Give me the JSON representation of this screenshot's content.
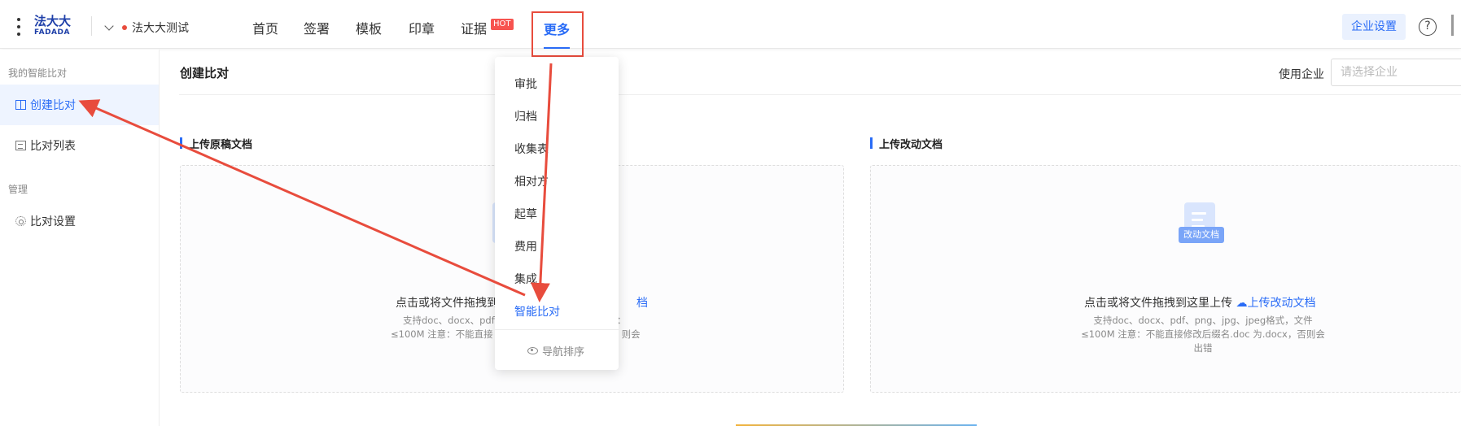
{
  "header": {
    "logo_top": "法大大",
    "logo_bottom": "FADADA",
    "org_name": "法大大测试",
    "nav": [
      "首页",
      "签署",
      "模板",
      "印章",
      "证据"
    ],
    "hot_badge": "HOT",
    "more_label": "更多",
    "settings_button": "企业设置",
    "help_glyph": "?"
  },
  "sidebar": {
    "group1": "我的智能比对",
    "items": [
      {
        "label": "创建比对"
      },
      {
        "label": "比对列表"
      }
    ],
    "group2": "管理",
    "settings_item": "比对设置"
  },
  "main": {
    "title": "创建比对",
    "enterprise_label": "使用企业",
    "enterprise_placeholder": "请选择企业",
    "original": {
      "section_title": "上传原稿文档",
      "prompt_a": "点击或将文件拖拽到",
      "prompt_link": "档",
      "hint_line1a": "支持doc、docx、pdf",
      "hint_line1b": "：",
      "hint_line2a": "≤100M 注意：不能直接",
      "hint_line2b": "则会"
    },
    "revised": {
      "section_title": "上传改动文档",
      "icon_tag": "改动文档",
      "prompt": "点击或将文件拖拽到这里上传",
      "link": "上传改动文档",
      "hint_line1": "支持doc、docx、pdf、png、jpg、jpeg格式，文件",
      "hint_line2": "≤100M 注意：不能直接修改后缀名.doc 为.docx，否则会",
      "hint_line3": "出错"
    }
  },
  "dropdown": {
    "items": [
      "审批",
      "归档",
      "收集表",
      "相对方",
      "起草",
      "费用",
      "集成",
      "智能比对"
    ],
    "active_item": "智能比对",
    "footer": "导航排序"
  },
  "colors": {
    "accent": "#2a6cf6",
    "annotation": "#e84c3d",
    "hot": "#f7534f"
  }
}
